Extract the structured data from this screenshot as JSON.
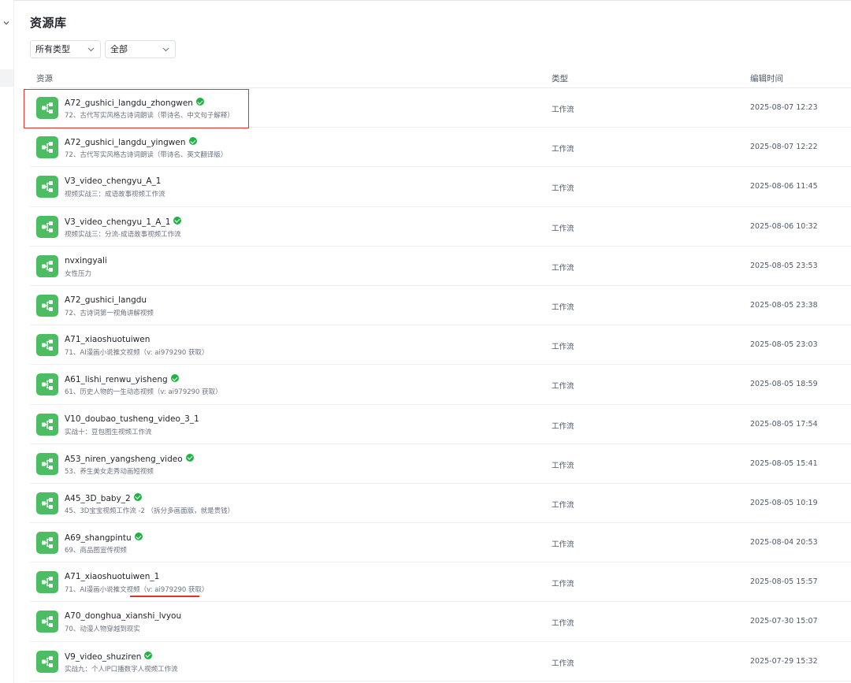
{
  "page": {
    "title": "资源库"
  },
  "filters": {
    "type": {
      "value": "所有类型"
    },
    "scope": {
      "value": "全部"
    }
  },
  "table": {
    "columns": {
      "resource": "资源",
      "type": "类型",
      "edit_time": "编辑时间"
    },
    "rows": [
      {
        "name": "A72_gushici_langdu_zhongwen",
        "published": true,
        "desc": "72、古代写实风格古诗词朗读（带诗名、中文句子解释）",
        "type": "工作流",
        "time": "2025-08-07 12:23"
      },
      {
        "name": "A72_gushici_langdu_yingwen",
        "published": true,
        "desc": "72、古代写实风格古诗词朗读（带诗名、英文翻译版）",
        "type": "工作流",
        "time": "2025-08-07 12:22"
      },
      {
        "name": "V3_video_chengyu_A_1",
        "published": false,
        "desc": "视频实战三：成语故事视频工作流",
        "type": "工作流",
        "time": "2025-08-06 11:45"
      },
      {
        "name": "V3_video_chengyu_1_A_1",
        "published": true,
        "desc": "视频实战三：分流-成语故事视频工作流",
        "type": "工作流",
        "time": "2025-08-06 10:32"
      },
      {
        "name": "nvxingyali",
        "published": false,
        "desc": "女性压力",
        "type": "工作流",
        "time": "2025-08-05 23:53"
      },
      {
        "name": "A72_gushici_langdu",
        "published": false,
        "desc": "72、古诗词第一视角讲解视频",
        "type": "工作流",
        "time": "2025-08-05 23:38"
      },
      {
        "name": "A71_xiaoshuotuiwen",
        "published": false,
        "desc": "71、AI漫画小说推文视频（v: ai979290 获取）",
        "type": "工作流",
        "time": "2025-08-05 23:03"
      },
      {
        "name": "A61_lishi_renwu_yisheng",
        "published": true,
        "desc": "61、历史人物的一生动态视频（v: ai979290 获取）",
        "type": "工作流",
        "time": "2025-08-05 18:59"
      },
      {
        "name": "V10_doubao_tusheng_video_3_1",
        "published": false,
        "desc": "实战十：豆包图生视频工作流",
        "type": "工作流",
        "time": "2025-08-05 17:54"
      },
      {
        "name": "A53_niren_yangsheng_video",
        "published": true,
        "desc": "53、养生美女走秀动画短视频",
        "type": "工作流",
        "time": "2025-08-05 15:41"
      },
      {
        "name": "A45_3D_baby_2",
        "published": true,
        "desc": "45、3D宝宝视频工作流 -2 （拆分多画面版，就是贵钱）",
        "type": "工作流",
        "time": "2025-08-05 10:19"
      },
      {
        "name": "A69_shangpintu",
        "published": true,
        "desc": "69、商品图宣传视频",
        "type": "工作流",
        "time": "2025-08-04 20:53"
      },
      {
        "name": "A71_xiaoshuotuiwen_1",
        "published": false,
        "desc": "71、AI漫画小说推文视频（v: ai979290 获取）",
        "type": "工作流",
        "time": "2025-08-05 15:57"
      },
      {
        "name": "A70_donghua_xianshi_lvyou",
        "published": false,
        "desc": "70、动漫人物穿越到现实",
        "type": "工作流",
        "time": "2025-07-30 15:07"
      },
      {
        "name": "V9_video_shuziren",
        "published": true,
        "desc": "实战九：个人IP口播数字人视频工作流",
        "type": "工作流",
        "time": "2025-07-29 15:32"
      }
    ]
  },
  "icons": {
    "workflow": "workflow-icon",
    "published": "check-circle-icon",
    "dropdown": "chevron-down-icon"
  },
  "colors": {
    "workflow_icon_bg": "#4cbd62",
    "published_badge": "#1fb345",
    "annotation_red": "#e0352b"
  }
}
